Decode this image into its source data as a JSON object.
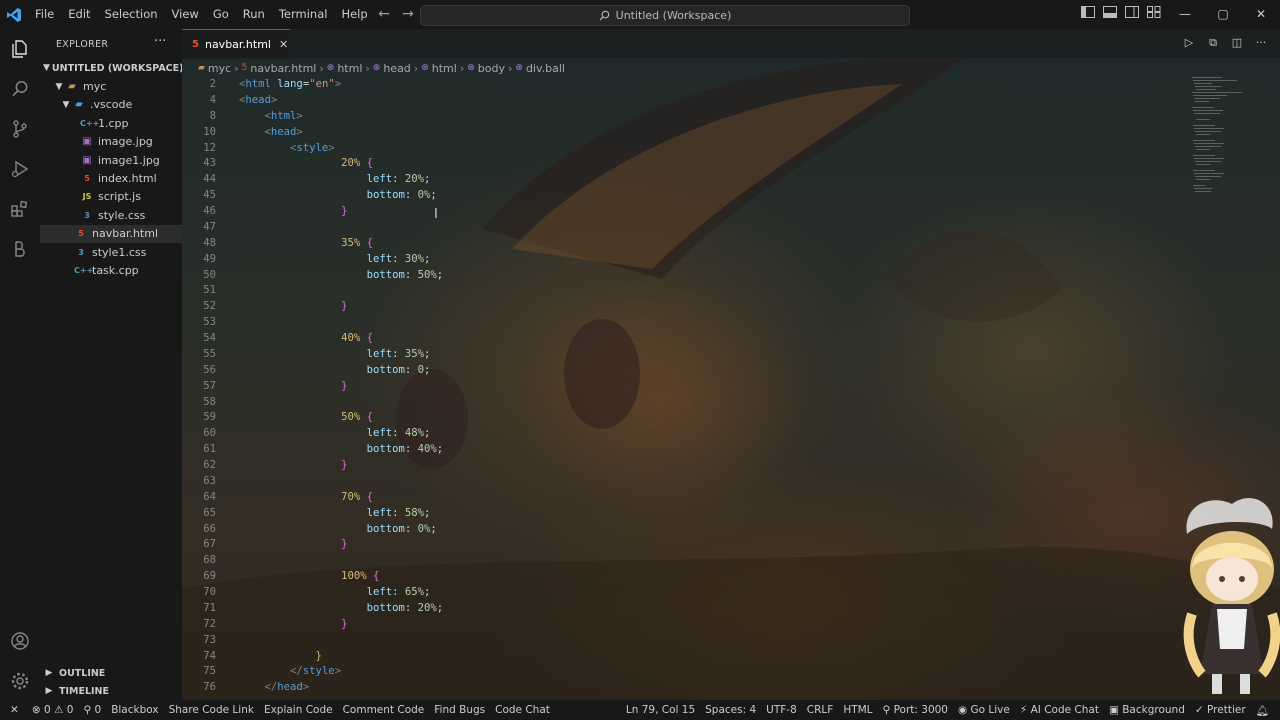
{
  "menu": [
    "File",
    "Edit",
    "Selection",
    "View",
    "Go",
    "Run",
    "Terminal",
    "Help"
  ],
  "command_center": "Untitled (Workspace)",
  "window_controls": [
    "—",
    "▢",
    "✕"
  ],
  "explorer": {
    "title": "EXPLORER",
    "workspace": "UNTITLED (WORKSPACE)",
    "folder": "myc",
    "subfolder": ".vscode",
    "files": [
      {
        "name": "1.cpp",
        "badge": "C++",
        "color": "#519aba"
      },
      {
        "name": "image.jpg",
        "badge": "▣",
        "color": "#a074c4"
      },
      {
        "name": "image1.jpg",
        "badge": "▣",
        "color": "#a074c4"
      },
      {
        "name": "index.html",
        "badge": "5",
        "color": "#e44d26"
      },
      {
        "name": "script.js",
        "badge": "JS",
        "color": "#cbcb41"
      },
      {
        "name": "style.css",
        "badge": "3",
        "color": "#519aba"
      },
      {
        "name": "navbar.html",
        "badge": "5",
        "color": "#e44d26"
      },
      {
        "name": "style1.css",
        "badge": "3",
        "color": "#519aba"
      },
      {
        "name": "task.cpp",
        "badge": "C++",
        "color": "#519aba"
      }
    ],
    "outline": "OUTLINE",
    "timeline": "TIMELINE"
  },
  "tab": {
    "name": "navbar.html",
    "close": "✕"
  },
  "breadcrumb": [
    "myc",
    "navbar.html",
    "html",
    "head",
    "html",
    "body",
    "div.ball"
  ],
  "code_lines": [
    {
      "n": "2",
      "indent": "",
      "kind": "tag",
      "t": "html",
      "a": "lang",
      "v": "\"en\""
    },
    {
      "n": "4",
      "indent": "",
      "kind": "tag",
      "t": "head"
    },
    {
      "n": "8",
      "indent": "    ",
      "kind": "tag",
      "t": "html"
    },
    {
      "n": "10",
      "indent": "    ",
      "kind": "tag",
      "t": "head"
    },
    {
      "n": "12",
      "indent": "        ",
      "kind": "tag",
      "t": "style"
    },
    {
      "n": "43",
      "indent": "                ",
      "kind": "key",
      "k": "20%"
    },
    {
      "n": "44",
      "indent": "                    ",
      "kind": "prop",
      "p": "left",
      "v": "20%"
    },
    {
      "n": "45",
      "indent": "                    ",
      "kind": "prop",
      "p": "bottom",
      "v": "0%"
    },
    {
      "n": "46",
      "indent": "                ",
      "kind": "close"
    },
    {
      "n": "47",
      "indent": "",
      "kind": "blank"
    },
    {
      "n": "48",
      "indent": "                ",
      "kind": "key",
      "k": "35%"
    },
    {
      "n": "49",
      "indent": "                    ",
      "kind": "prop",
      "p": "left",
      "v": "30%"
    },
    {
      "n": "50",
      "indent": "                    ",
      "kind": "prop",
      "p": "bottom",
      "v": "50%"
    },
    {
      "n": "51",
      "indent": "",
      "kind": "blank"
    },
    {
      "n": "52",
      "indent": "                ",
      "kind": "close"
    },
    {
      "n": "53",
      "indent": "",
      "kind": "blank"
    },
    {
      "n": "54",
      "indent": "                ",
      "kind": "key",
      "k": "40%"
    },
    {
      "n": "55",
      "indent": "                    ",
      "kind": "prop",
      "p": "left",
      "v": "35%"
    },
    {
      "n": "56",
      "indent": "                    ",
      "kind": "prop",
      "p": "bottom",
      "v": "0"
    },
    {
      "n": "57",
      "indent": "                ",
      "kind": "close"
    },
    {
      "n": "58",
      "indent": "",
      "kind": "blank"
    },
    {
      "n": "59",
      "indent": "                ",
      "kind": "key",
      "k": "50%"
    },
    {
      "n": "60",
      "indent": "                    ",
      "kind": "prop",
      "p": "left",
      "v": "48%"
    },
    {
      "n": "61",
      "indent": "                    ",
      "kind": "prop",
      "p": "bottom",
      "v": "40%"
    },
    {
      "n": "62",
      "indent": "                ",
      "kind": "close"
    },
    {
      "n": "63",
      "indent": "",
      "kind": "blank"
    },
    {
      "n": "64",
      "indent": "                ",
      "kind": "key",
      "k": "70%"
    },
    {
      "n": "65",
      "indent": "                    ",
      "kind": "prop",
      "p": "left",
      "v": "58%"
    },
    {
      "n": "66",
      "indent": "                    ",
      "kind": "prop",
      "p": "bottom",
      "v": "0%"
    },
    {
      "n": "67",
      "indent": "                ",
      "kind": "close"
    },
    {
      "n": "68",
      "indent": "",
      "kind": "blank"
    },
    {
      "n": "69",
      "indent": "                ",
      "kind": "key",
      "k": "100%"
    },
    {
      "n": "70",
      "indent": "                    ",
      "kind": "prop",
      "p": "left",
      "v": "65%"
    },
    {
      "n": "71",
      "indent": "                    ",
      "kind": "prop",
      "p": "bottom",
      "v": "20%"
    },
    {
      "n": "72",
      "indent": "                ",
      "kind": "close"
    },
    {
      "n": "73",
      "indent": "",
      "kind": "blank"
    },
    {
      "n": "74",
      "indent": "            ",
      "kind": "closeplain"
    },
    {
      "n": "75",
      "indent": "        ",
      "kind": "endtag",
      "t": "style"
    },
    {
      "n": "76",
      "indent": "    ",
      "kind": "endtag",
      "t": "head"
    }
  ],
  "status": {
    "remote": "✕",
    "errors": "0",
    "warnings": "0",
    "ports": "0",
    "left_items": [
      "Blackbox",
      "Share Code Link",
      "Explain Code",
      "Comment Code",
      "Find Bugs",
      "Code Chat"
    ],
    "position": "Ln 79, Col 15",
    "spaces": "Spaces: 4",
    "encoding": "UTF-8",
    "eol": "CRLF",
    "language": "HTML",
    "port": "Port: 3000",
    "go_live": "Go Live",
    "ai_chat": "AI Code Chat",
    "background": "Background",
    "prettier": "Prettier"
  },
  "colors": {
    "accent": "#0078d4",
    "html_icon": "#e44d26",
    "css_icon": "#519aba",
    "js_icon": "#cbcb41"
  }
}
